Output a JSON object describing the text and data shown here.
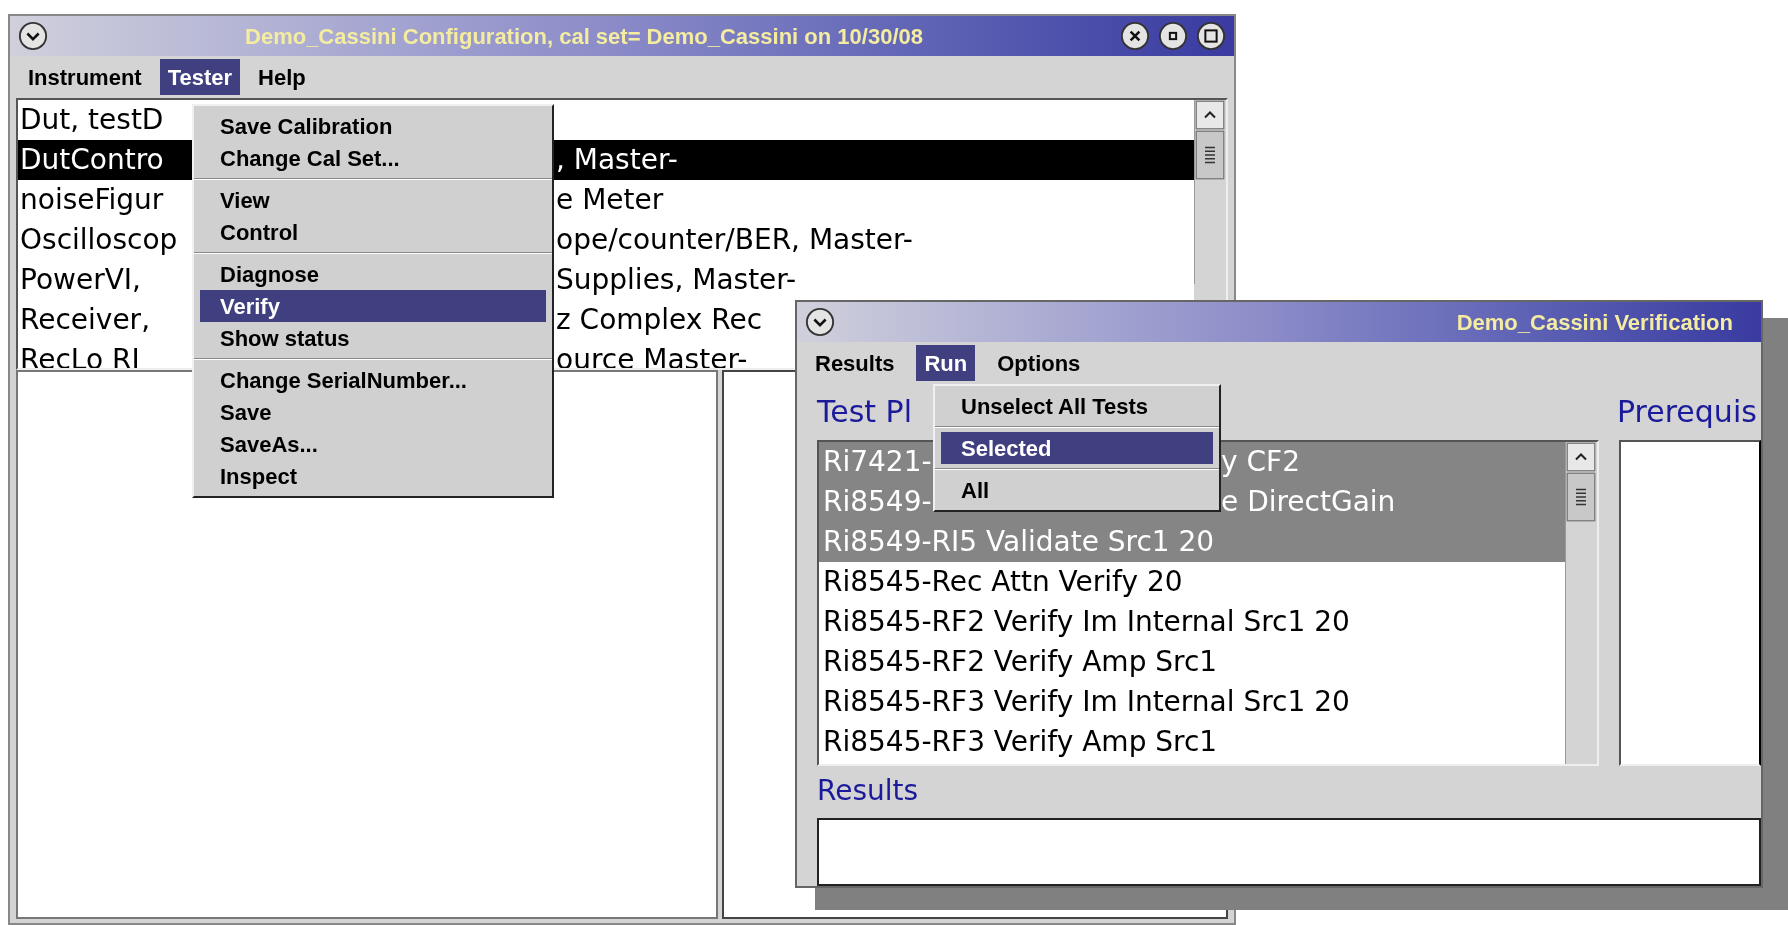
{
  "config_window": {
    "title": "Demo_Cassini Configuration,  cal set= Demo_Cassini on 10/30/08",
    "menu": [
      {
        "label": "Instrument",
        "selected": false
      },
      {
        "label": "Tester",
        "selected": true
      },
      {
        "label": "Help",
        "selected": false
      }
    ],
    "list_rows": [
      {
        "left": "Dut,  testD",
        "selected": false
      },
      {
        "left": "DutContro",
        "right": ", Master-",
        "selected": true
      },
      {
        "left": "noiseFigur",
        "right": "e Meter",
        "selected": false
      },
      {
        "left": "Oscilloscop",
        "right": "ope/counter/BER, Master-",
        "selected": false
      },
      {
        "left": "PowerVI,",
        "right": "Supplies, Master-",
        "selected": false
      },
      {
        "left": "Receiver,",
        "right": "z Complex Rec",
        "selected": false
      },
      {
        "left": "RecLo  RI",
        "right": "ource  Master-",
        "selected": false
      }
    ],
    "tester_menu": [
      [
        {
          "label": "Save Calibration",
          "selected": false
        },
        {
          "label": "Change Cal Set...",
          "selected": false
        }
      ],
      [
        {
          "label": "View",
          "selected": false
        },
        {
          "label": "Control",
          "selected": false
        }
      ],
      [
        {
          "label": "Diagnose",
          "selected": false
        },
        {
          "label": "Verify",
          "selected": true
        },
        {
          "label": "Show status",
          "selected": false
        }
      ],
      [
        {
          "label": "Change SerialNumber...",
          "selected": false
        },
        {
          "label": "Save",
          "selected": false
        },
        {
          "label": "SaveAs...",
          "selected": false
        },
        {
          "label": "Inspect",
          "selected": false
        }
      ]
    ]
  },
  "verification_window": {
    "title": "Demo_Cassini Verification",
    "menu": [
      {
        "label": "Results",
        "selected": false
      },
      {
        "label": "Run",
        "selected": true
      },
      {
        "label": "Options",
        "selected": false
      }
    ],
    "test_plan_label": "Test Pl",
    "prerequisites_label": "Prerequis",
    "tests": [
      {
        "left": "Ri7421-",
        "right": "y CF2",
        "selected": true
      },
      {
        "left": "Ri8549-",
        "right": "e DirectGain",
        "selected": true
      },
      {
        "left": "Ri8549-RI5 Validate Src1 20",
        "selected": true
      },
      {
        "left": "Ri8545-Rec Attn Verify 20",
        "selected": false
      },
      {
        "left": "Ri8545-RF2 Verify Im Internal Src1 20",
        "selected": false
      },
      {
        "left": "Ri8545-RF2 Verify Amp Src1",
        "selected": false
      },
      {
        "left": "Ri8545-RF3 Verify Im Internal Src1 20",
        "selected": false
      },
      {
        "left": "Ri8545-RF3 Verify Amp Src1",
        "selected": false
      }
    ],
    "results_label": "Results",
    "run_menu": [
      [
        {
          "label": "Unselect All Tests",
          "selected": false
        }
      ],
      [
        {
          "label": "Selected",
          "selected": true
        }
      ],
      [
        {
          "label": "All",
          "selected": false
        }
      ]
    ]
  }
}
